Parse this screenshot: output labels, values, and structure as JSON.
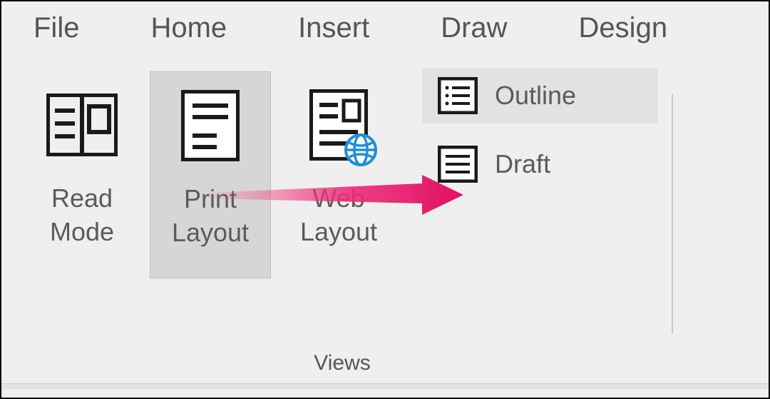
{
  "tabs": {
    "file": "File",
    "home": "Home",
    "insert": "Insert",
    "draw": "Draw",
    "design": "Design"
  },
  "views": {
    "read_mode": "Read\nMode",
    "print_layout": "Print\nLayout",
    "web_layout": "Web\nLayout",
    "outline": "Outline",
    "draft": "Draft"
  },
  "group_label": "Views"
}
